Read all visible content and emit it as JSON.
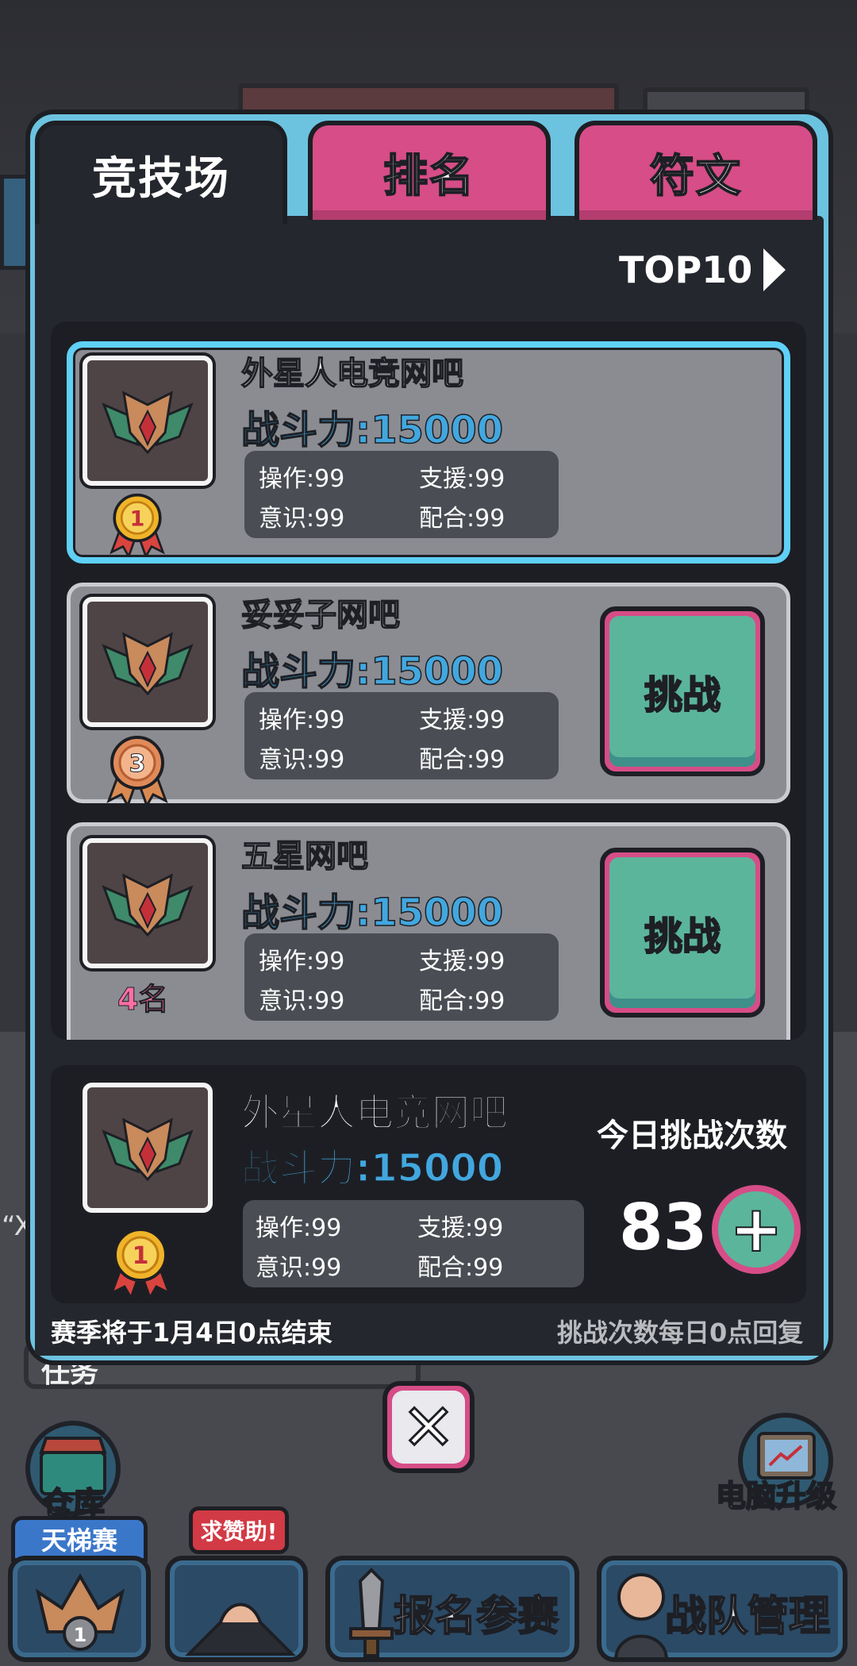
{
  "tabs": [
    {
      "label": "竞技场",
      "active": true
    },
    {
      "label": "排名",
      "active": false
    },
    {
      "label": "符文",
      "active": false
    }
  ],
  "top10_label": "TOP10",
  "stat_labels": {
    "operate": "操作:99",
    "support": "支援:99",
    "awareness": "意识:99",
    "coordination": "配合:99"
  },
  "list": [
    {
      "name": "外星人电竞网吧",
      "power": "战斗力:15000",
      "rank": "1",
      "selected": true
    },
    {
      "name": "妥妥子网吧",
      "power": "战斗力:15000",
      "rank": "3",
      "challenge_label": "挑战"
    },
    {
      "name": "五星网吧",
      "power": "战斗力:15000",
      "rank_label": "4名",
      "challenge_label": "挑战"
    }
  ],
  "mine": {
    "name": "外星人电竞网吧",
    "power": "战斗力:15000",
    "rank": "1",
    "today_label": "今日挑战次数",
    "count": "83"
  },
  "footer": {
    "season_end": "赛季将于1月4日0点结束",
    "reset_note": "挑战次数每日0点回复"
  },
  "bottom": {
    "warehouse": "仓库",
    "pc_upgrade": "电脑升级",
    "ladder_tag": "天梯赛",
    "ladder_rank": "1",
    "help_tag": "求赞助!",
    "signup": "报名参赛",
    "team": "战队管理"
  },
  "background": {
    "mission_label": "任务",
    "left_fragment": "“X"
  },
  "colors": {
    "accent_blue": "#6cc3e0",
    "pink": "#d64d87",
    "teal": "#5bb59b",
    "power_blue": "#42a7df",
    "rank4_pink": "#ff6fa4"
  }
}
